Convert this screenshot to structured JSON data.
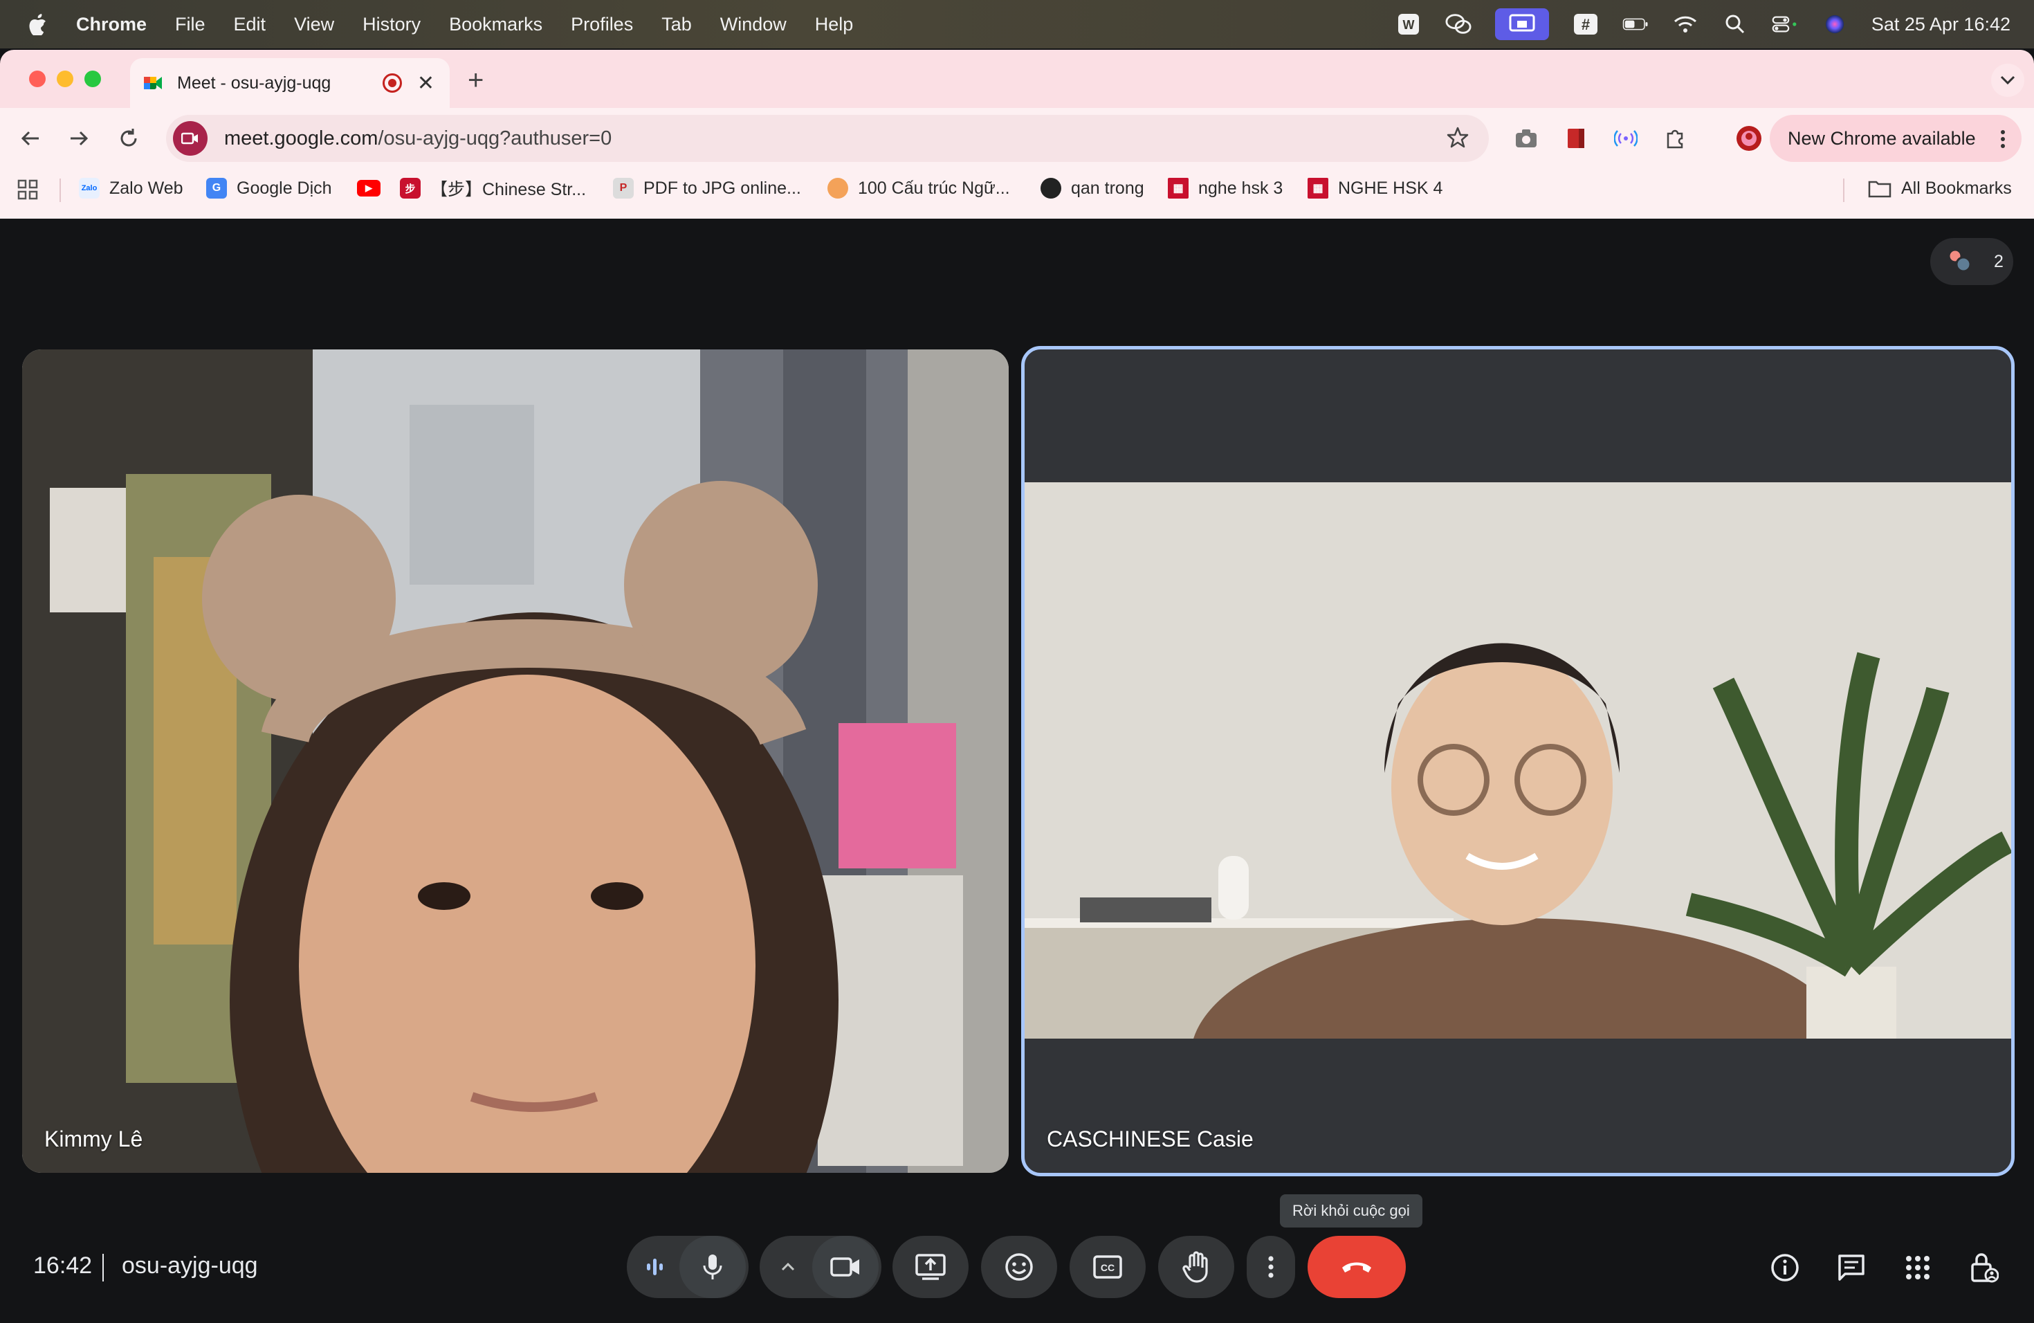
{
  "menubar": {
    "app_name": "Chrome",
    "menus": [
      "File",
      "Edit",
      "View",
      "History",
      "Bookmarks",
      "Profiles",
      "Tab",
      "Window",
      "Help"
    ],
    "clock": "Sat 25 Apr  16:42",
    "status_icons": [
      "wps-icon",
      "wechat-icon",
      "screen-share-icon",
      "hashtag-icon",
      "battery-icon",
      "wifi-icon",
      "spotlight-icon",
      "control-center-icon",
      "siri-icon"
    ]
  },
  "tab": {
    "title": "Meet - osu-ayjg-uqg"
  },
  "omnibox": {
    "host": "meet.google.com",
    "path": "/osu-ayjg-uqg?authuser=0"
  },
  "update_button": {
    "label": "New Chrome available"
  },
  "bookmarks": {
    "items": [
      {
        "label": "Zalo Web",
        "color": "#0068ff",
        "icon": "Zalo"
      },
      {
        "label": "Google Dịch",
        "color": "#4285f4",
        "icon": "G"
      },
      {
        "label": "",
        "color": "#ff0000",
        "icon": "▶"
      },
      {
        "label": "【步】Chinese Str...",
        "color": "#c8102e",
        "icon": "步"
      },
      {
        "label": "PDF to JPG online...",
        "color": "#e8e8e8",
        "icon": "P"
      },
      {
        "label": "100 Cấu trúc Ngữ...",
        "color": "#f4a259",
        "icon": "●"
      },
      {
        "label": "qan trong",
        "color": "#222222",
        "icon": "◐"
      },
      {
        "label": "nghe hsk 3",
        "color": "#c8102e",
        "icon": "▦"
      },
      {
        "label": "NGHE HSK 4",
        "color": "#c8102e",
        "icon": "▦"
      }
    ],
    "all_bookmarks": "All Bookmarks"
  },
  "meet": {
    "participants_count": "2",
    "tiles": [
      {
        "name": "Kimmy Lê"
      },
      {
        "name": "CASCHINESE Casie"
      }
    ],
    "time": "16:42",
    "meeting_code": "osu-ayjg-uqg",
    "hangup_tooltip": "Rời khỏi cuộc gọi"
  },
  "colors": {
    "accent_border": "#a8c7fa",
    "hangup": "#e94235",
    "tabstrip": "#fbdfe4"
  }
}
